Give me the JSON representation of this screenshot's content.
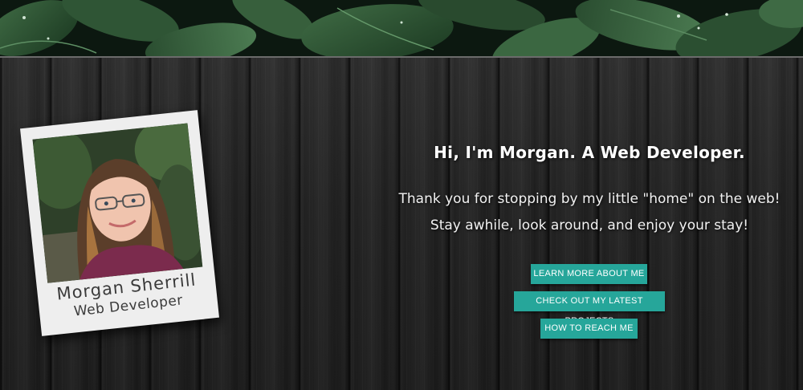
{
  "polaroid": {
    "name": "Morgan Sherrill",
    "role": "Web Developer"
  },
  "hero": {
    "heading": "Hi, I'm Morgan. A Web Developer.",
    "intro_line1": "Thank you for stopping by my little \"home\" on the web!",
    "intro_line2": "Stay awhile, look around, and enjoy your stay!"
  },
  "buttons": {
    "about": "LEARN MORE ABOUT ME",
    "projects": "CHECK OUT MY LATEST PROJECTS",
    "contact": "HOW TO REACH ME"
  },
  "colors": {
    "button": "#26a69a",
    "wood": "#262626",
    "polaroid_frame": "#eeeeee",
    "text": "#ffffff"
  }
}
